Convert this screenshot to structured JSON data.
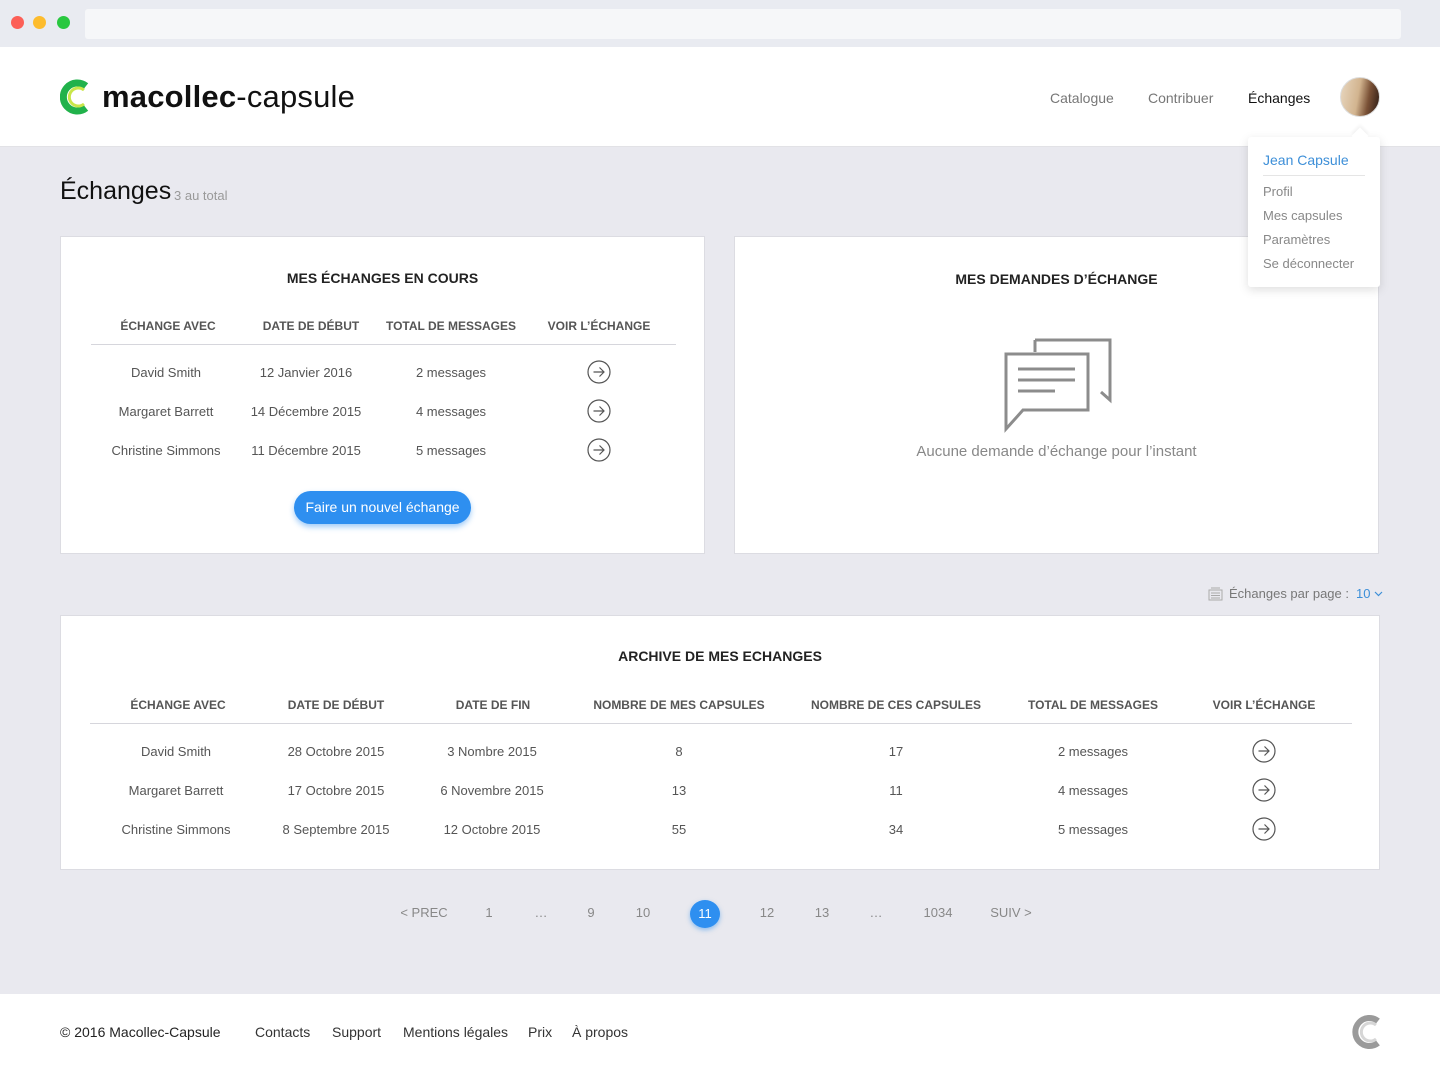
{
  "brand": {
    "bold": "macollec",
    "rest": "-capsule"
  },
  "nav": {
    "catalogue": "Catalogue",
    "contribuer": "Contribuer",
    "echanges": "Échanges"
  },
  "user_menu": {
    "user_name": "Jean Capsule",
    "items": [
      "Profil",
      "Mes capsules",
      "Paramètres",
      "Se déconnecter"
    ]
  },
  "page": {
    "title": "Échanges",
    "count": "3 au total"
  },
  "current": {
    "title": "MES ÉCHANGES EN COURS",
    "headers": [
      "ÉCHANGE AVEC",
      "DATE DE DÉBUT",
      "TOTAL DE MESSAGES",
      "VOIR L’ÉCHANGE"
    ],
    "rows": [
      {
        "name": "David Smith",
        "date": "12 Janvier 2016",
        "messages": "2 messages"
      },
      {
        "name": "Margaret Barrett",
        "date": "14 Décembre 2015",
        "messages": "4 messages"
      },
      {
        "name": "Christine Simmons",
        "date": "11 Décembre 2015",
        "messages": "5 messages"
      }
    ],
    "button": "Faire un nouvel échange"
  },
  "requests": {
    "title": "MES DEMANDES D’ÉCHANGE",
    "empty": "Aucune demande d’échange pour l’instant"
  },
  "per_page": {
    "label": "Échanges par page :",
    "value": "10"
  },
  "archive": {
    "title": "ARCHIVE DE MES ECHANGES",
    "headers": [
      "ÉCHANGE AVEC",
      "DATE DE DÉBUT",
      "DATE DE FIN",
      "NOMBRE DE MES CAPSULES",
      "NOMBRE DE CES CAPSULES",
      "TOTAL DE MESSAGES",
      "VOIR L’ÉCHANGE"
    ],
    "rows": [
      {
        "name": "David Smith",
        "start": "28 Octobre 2015",
        "end": "3 Nombre 2015",
        "mine": "8",
        "theirs": "17",
        "messages": "2 messages"
      },
      {
        "name": "Margaret Barrett",
        "start": "17 Octobre 2015",
        "end": "6 Novembre 2015",
        "mine": "13",
        "theirs": "11",
        "messages": "4 messages"
      },
      {
        "name": "Christine Simmons",
        "start": "8 Septembre 2015",
        "end": "12 Octobre 2015",
        "mine": "55",
        "theirs": "34",
        "messages": "5 messages"
      }
    ]
  },
  "pagination": {
    "prev": "< PREC",
    "pages": [
      "1",
      "…",
      "9",
      "10",
      "11",
      "12",
      "13",
      "…",
      "1034"
    ],
    "current": "11",
    "next": "SUIV >"
  },
  "footer": {
    "copyright": "© 2016 Macollec-Capsule",
    "links": [
      "Contacts",
      "Support",
      "Mentions légales",
      "Prix",
      "À propos"
    ]
  },
  "colors": {
    "accent": "#2e8ff0",
    "link": "#3d8fd8",
    "background": "#e9e9ef",
    "logo_green": "#21b24b"
  }
}
